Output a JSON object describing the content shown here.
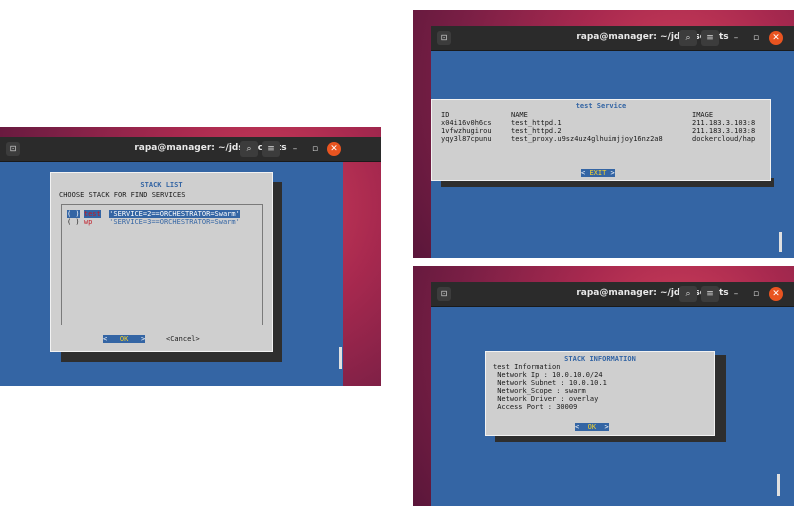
{
  "window_title": "rapa@manager: ~/jdss/scripts",
  "icons": {
    "terminal": "⊡",
    "search": "⌕",
    "menu": "≡",
    "minimize": "–",
    "maximize": "▫",
    "close": "✕"
  },
  "colors": {
    "terminal_bg": "#3465a4",
    "dialog_bg": "#cfcfcf",
    "close_button": "#e95420"
  },
  "stack_list": {
    "title": "STACK LIST",
    "prompt": "CHOOSE STACK FOR FIND SERVICES",
    "items": [
      {
        "radio": "( )",
        "name": "test",
        "value": "'SERVICE=2==ORCHESTRATOR=Swarm'",
        "selected": true
      },
      {
        "radio": "( )",
        "name": "wp",
        "value": "'SERVICE=3==ORCHESTRATOR=Swarm'",
        "selected": false
      }
    ],
    "ok_left": "<",
    "ok_label": "OK",
    "ok_right": ">",
    "cancel_label": "<Cancel>"
  },
  "service": {
    "title": "test Service",
    "columns": [
      "ID",
      "NAME",
      "IMAGE"
    ],
    "rows": [
      [
        "x04i16v0h6cs",
        "test_httpd.1",
        "211.183.3.103:8"
      ],
      [
        "1vfwzhugirou",
        "test_httpd.2",
        "211.183.3.103:8"
      ],
      [
        "yqy3l87cpunu",
        "test_proxy.u9sz4uz4glhuimjjoy16nz2a8",
        "dockercloud/hap"
      ]
    ],
    "exit_left": "<",
    "exit_label": "EXIT",
    "exit_right": ">"
  },
  "stack_info": {
    "title": "STACK INFORMATION",
    "lines": [
      "test Information",
      " Network Ip : 10.0.10.0/24",
      " Network Subnet : 10.0.10.1",
      " Network_Scope : swarm",
      " Network Driver : overlay",
      " Access Port : 30009"
    ],
    "ok_left": "<",
    "ok_label": "OK",
    "ok_right": ">"
  }
}
